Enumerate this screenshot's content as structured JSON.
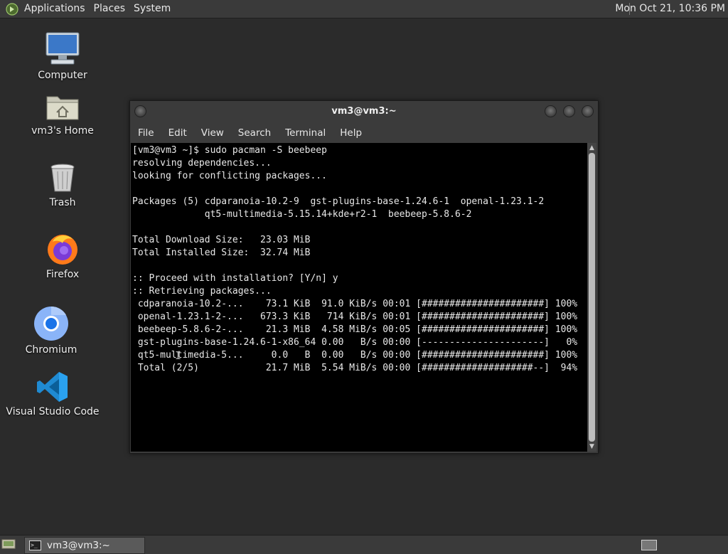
{
  "top_panel": {
    "menus": [
      "Applications",
      "Places",
      "System"
    ],
    "clock": "Mon Oct 21, 10:36 PM"
  },
  "desktop_icons": [
    {
      "label": "Computer",
      "icon": "computer-icon"
    },
    {
      "label": "vm3's Home",
      "icon": "home-folder-icon"
    },
    {
      "label": "Trash",
      "icon": "trash-icon"
    },
    {
      "label": "Firefox",
      "icon": "firefox-icon"
    },
    {
      "label": "Chromium",
      "icon": "chromium-icon"
    },
    {
      "label": "Visual Studio Code",
      "icon": "vscode-icon"
    }
  ],
  "terminal": {
    "title": "vm3@vm3:~",
    "menu": [
      "File",
      "Edit",
      "View",
      "Search",
      "Terminal",
      "Help"
    ],
    "lines": [
      "[vm3@vm3 ~]$ sudo pacman -S beebeep",
      "resolving dependencies...",
      "looking for conflicting packages...",
      "",
      "Packages (5) cdparanoia-10.2-9  gst-plugins-base-1.24.6-1  openal-1.23.1-2",
      "             qt5-multimedia-5.15.14+kde+r2-1  beebeep-5.8.6-2",
      "",
      "Total Download Size:   23.03 MiB",
      "Total Installed Size:  32.74 MiB",
      "",
      ":: Proceed with installation? [Y/n] y",
      ":: Retrieving packages...",
      " cdparanoia-10.2-...    73.1 KiB  91.0 KiB/s 00:01 [######################] 100%",
      " openal-1.23.1-2-...   673.3 KiB   714 KiB/s 00:01 [######################] 100%",
      " beebeep-5.8.6-2-...    21.3 MiB  4.58 MiB/s 00:05 [######################] 100%",
      " gst-plugins-base-1.24.6-1-x86_64 0.00   B/s 00:00 [----------------------]   0%",
      " qt5-multimedia-5...     0.0   B  0.00   B/s 00:00 [######################] 100%",
      " Total (2/5)            21.7 MiB  5.54 MiB/s 00:00 [####################--]  94%"
    ]
  },
  "taskbar": {
    "window_button": "vm3@vm3:~"
  },
  "colors": {
    "desktop": "#2b2b2b",
    "panel": "#3a3a3a",
    "terminal_bg": "#000000",
    "terminal_fg": "#e8e8e8"
  }
}
